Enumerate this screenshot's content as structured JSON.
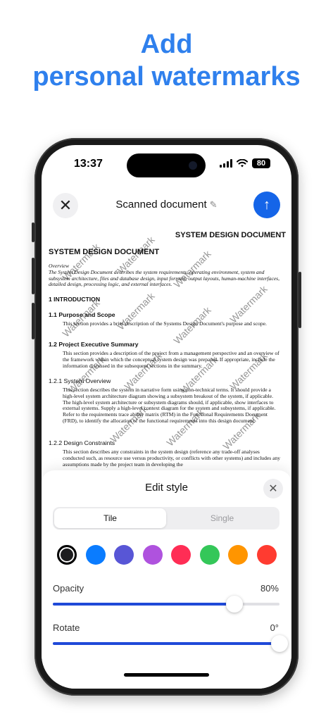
{
  "headline": {
    "line1": "Add",
    "line2": "personal watermarks"
  },
  "status_bar": {
    "time": "13:37",
    "battery": "80"
  },
  "topbar": {
    "title": "Scanned document",
    "edit_glyph": "✎",
    "close_glyph": "✕",
    "share_glyph": "↑"
  },
  "document": {
    "header_right": "SYSTEM DESIGN DOCUMENT",
    "header_left": "SYSTEM DESIGN DOCUMENT",
    "overview_label": "Overview",
    "overview_text": "The System Design Document describes the system requirements, operating environment, system and subsystem architecture, files and database design, input formats, output layouts, human-machine interfaces, detailed design, processing logic, and external interfaces.",
    "s1": "1     INTRODUCTION",
    "s11": "1.1   Purpose and Scope",
    "s11_text": "This section provides a brief description of the Systems Design Document's purpose and scope.",
    "s12": "1.2   Project Executive Summary",
    "s12_text": "This section provides a description of the project from a management perspective and an overview of the framework within which the conceptual system design was prepared. If appropriate, include the information discussed in the subsequent sections in the summary.",
    "s121": "1.2.1   System Overview",
    "s121_text": "This section describes the system in narrative form using non-technical terms. It should provide a high-level system architecture diagram showing a subsystem breakout of the system, if applicable. The high-level system architecture or subsystem diagrams should, if applicable, show interfaces to external systems. Supply a high-level context diagram for the system and subsystems, if applicable. Refer to the requirements trace ability matrix (RTM) in the Functional Requirements Document (FRD), to identify the allocation of the functional requirements into this design document.",
    "s122": "1.2.2   Design Constraints",
    "s122_text": "This section describes any constraints in the system design (reference any trade-off analyses conducted such, as resource use versus productivity, or conflicts with other systems) and includes any assumptions made by the project team in developing the",
    "watermark_text": "Watermark"
  },
  "edit_style": {
    "title": "Edit style",
    "close_glyph": "✕",
    "tabs": {
      "tile": "Tile",
      "single": "Single"
    },
    "selected_tab": "Tile",
    "colors": [
      "#1c1c1e",
      "#0a7cff",
      "#5856d6",
      "#af52de",
      "#ff2d55",
      "#34c759",
      "#ff9500",
      "#ff3b30"
    ],
    "selected_color": "#1c1c1e",
    "opacity": {
      "label": "Opacity",
      "value_text": "80%",
      "value": 0.8
    },
    "rotate": {
      "label": "Rotate",
      "value_text": "0°",
      "value": 1.0
    }
  }
}
